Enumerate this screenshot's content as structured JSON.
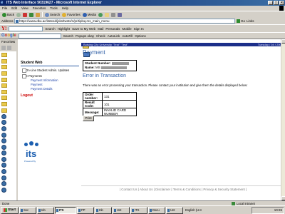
{
  "window": {
    "title": "ITS Web Interface 50319627 - Microsoft Internet Explorer"
  },
  "menu": [
    "File",
    "Edit",
    "View",
    "Favorites",
    "Tools",
    "Help"
  ],
  "toolbar": {
    "back": "Back",
    "search": "Search",
    "favorites": "Favorites",
    "media": "Media"
  },
  "address": {
    "label": "Address",
    "url": "https://www.dku.ac/itsteed/jsks/twsts/1/pr/tiplsq.ms_main_menu",
    "go": "Go",
    "links": "Links"
  },
  "yahoo": {
    "logo": "Y!",
    "items": [
      "Search",
      "Highlight",
      "Save to My Web",
      "Mail",
      "Personals",
      "Mobile",
      "Sign In"
    ]
  },
  "google": {
    "logo": "Google",
    "items": [
      "Search",
      "Popups okay",
      "Check",
      "AutoLink",
      "AutoFill",
      "Options"
    ]
  },
  "favorites_pane": {
    "title": "Favorites",
    "close": "x",
    "row_count": 23
  },
  "page": {
    "header_strip_left": "Botsing City University  \"Test\"  \"Test\"",
    "header_strip_right": "Tuesday / 04 / 2006",
    "heading": "Payment",
    "student_number_label": "Student Number:",
    "name_label": "Name:",
    "name_prefix": "MS",
    "error_heading": "Error in Transaction",
    "message": "There was an error processing your transaction. Please contact your institution and give them the details displayed below:",
    "table": [
      {
        "label": "Order number:",
        "value": "131"
      },
      {
        "label": "Result Code:",
        "value": "101"
      },
      {
        "label": "Message:",
        "value": "INVALID CARD NUMBER"
      }
    ],
    "print_button": "Print",
    "footer": "| Contact Us | About Us | Disclaimer | Terms & Conditions | Privacy & Security Statement |"
  },
  "nav": {
    "title": "Student Web",
    "items": [
      {
        "label": "On-Line Student Admin. Updates"
      },
      {
        "label": "E-Payments"
      }
    ],
    "subitems": [
      "Payment Information",
      "Payment",
      "Payment Details"
    ],
    "logout": "Logout"
  },
  "its_logo": {
    "text": "its",
    "tagline": "Powered By"
  },
  "status": {
    "left": "Done",
    "zone": "Local intranet"
  },
  "taskbar": {
    "start": "Start",
    "items": [
      "Sec",
      "Inb",
      "ITS",
      "PP",
      "Inb",
      "Unt",
      "ITS",
      "Docu",
      "Unt"
    ],
    "active_index": 2,
    "lang": "English (U.K",
    "time": "10:26"
  }
}
